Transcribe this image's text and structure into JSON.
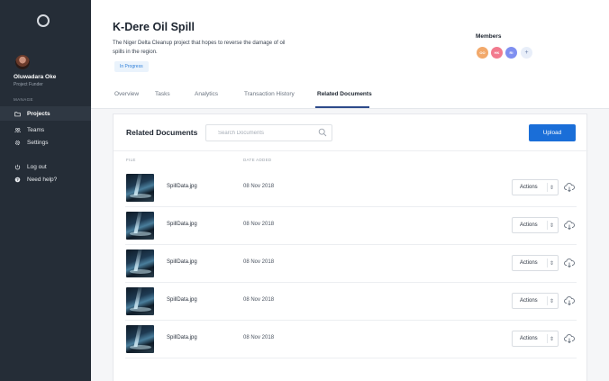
{
  "sidebar": {
    "user": {
      "name": "Oluwadara Oke",
      "role": "Project Funder"
    },
    "section_label": "MANAGE",
    "items": [
      {
        "label": "Projects",
        "icon": "folder-icon"
      },
      {
        "label": "Teams",
        "icon": "people-icon"
      },
      {
        "label": "Settings",
        "icon": "gear-icon"
      },
      {
        "label": "Log out",
        "icon": "power-icon"
      },
      {
        "label": "Need help?",
        "icon": "help-icon"
      }
    ]
  },
  "project": {
    "title": "K-Dere Oil Spill",
    "description": "The Niger Delta Cleanup project that hopes to reverse the damage of oil spills in the region.",
    "status": "In Progress"
  },
  "members": {
    "label": "Members",
    "list": [
      {
        "initials": "OO",
        "color": "#f2a96b"
      },
      {
        "initials": "HK",
        "color": "#f27a8e"
      },
      {
        "initials": "RI",
        "color": "#7f8ff0"
      }
    ],
    "add_symbol": "+"
  },
  "tabs": [
    {
      "label": "Overview"
    },
    {
      "label": "Tasks"
    },
    {
      "label": "Analytics"
    },
    {
      "label": "Transaction History"
    },
    {
      "label": "Related Documents",
      "active": true
    }
  ],
  "documents": {
    "title": "Related Documents",
    "search_placeholder": "Search Documents",
    "upload_label": "Upload",
    "columns": {
      "file": "FILE",
      "date": "DATE ADDED"
    },
    "rows": [
      {
        "name": "SpillData.jpg",
        "date": "08 Nov 2018",
        "action": "Actions"
      },
      {
        "name": "SpillData.jpg",
        "date": "08 Nov 2018",
        "action": "Actions"
      },
      {
        "name": "SpillData.jpg",
        "date": "08 Nov 2018",
        "action": "Actions"
      },
      {
        "name": "SpillData.jpg",
        "date": "08 Nov 2018",
        "action": "Actions"
      },
      {
        "name": "SpillData.jpg",
        "date": "08 Nov 2018",
        "action": "Actions"
      }
    ]
  },
  "colors": {
    "sidebar": "#252d37",
    "accent": "#1a6ed8",
    "tab_underline": "#2d4a8a",
    "status_bg": "#eaf3fc",
    "status_text": "#2f7fd9"
  }
}
